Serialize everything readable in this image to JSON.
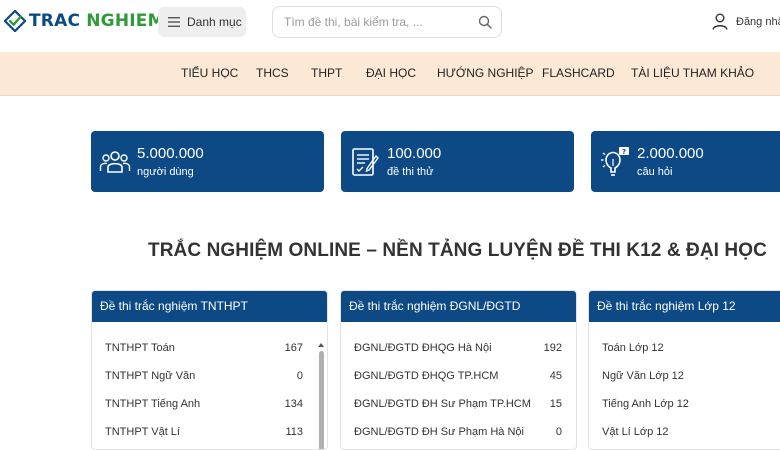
{
  "header": {
    "logo_main": "TRAC",
    "logo_accent": "NGHIEM",
    "menu_label": "Danh mục",
    "search_placeholder": "Tìm đề thi, bài kiểm tra, ...",
    "login_label": "Đăng nhập"
  },
  "nav": [
    {
      "label": "TIỂU HỌC"
    },
    {
      "label": "THCS"
    },
    {
      "label": "THPT"
    },
    {
      "label": "ĐẠI HỌC"
    },
    {
      "label": "HƯỚNG NGHIỆP"
    },
    {
      "label": "FLASHCARD"
    },
    {
      "label": "TÀI LIỆU THAM KHẢO"
    }
  ],
  "stats": [
    {
      "value": "5.000.000",
      "label": "người dùng",
      "icon": "users-icon"
    },
    {
      "value": "100.000",
      "label": "đề thi thử",
      "icon": "exam-sheet-icon"
    },
    {
      "value": "2.000.000",
      "label": "câu hỏi",
      "icon": "lightbulb-question-icon"
    }
  ],
  "heading": "TRẮC NGHIỆM ONLINE – NỀN TẢNG LUYỆN ĐỀ THI K12 & ĐẠI HỌC",
  "colors": {
    "brand_blue": "#0d4a85",
    "brand_green": "#2e9a3a",
    "nav_bg": "#fbe8d5"
  },
  "cards": [
    {
      "title": "Đề thi trắc nghiệm TNTHPT",
      "items": [
        {
          "name": "TNTHPT Toán",
          "count": "167"
        },
        {
          "name": "TNTHPT Ngữ Văn",
          "count": "0"
        },
        {
          "name": "TNTHPT Tiếng Anh",
          "count": "134"
        },
        {
          "name": "TNTHPT Vật Lí",
          "count": "113"
        }
      ]
    },
    {
      "title": "Đề thi trắc nghiệm ĐGNL/ĐGTD",
      "items": [
        {
          "name": "ĐGNL/ĐGTD ĐHQG Hà Nội",
          "count": "192"
        },
        {
          "name": "ĐGNL/ĐGTD ĐHQG TP.HCM",
          "count": "45"
        },
        {
          "name": "ĐGNL/ĐGTD ĐH Sư Phạm TP.HCM",
          "count": "15"
        },
        {
          "name": "ĐGNL/ĐGTD ĐH Sư Phạm Hà Nội",
          "count": "0"
        }
      ]
    },
    {
      "title": "Đề thi trắc nghiệm Lớp 12",
      "items": [
        {
          "name": "Toán Lớp 12",
          "count": ""
        },
        {
          "name": "Ngữ Văn Lớp 12",
          "count": ""
        },
        {
          "name": "Tiếng Anh Lớp 12",
          "count": ""
        },
        {
          "name": "Vật Lí Lớp 12",
          "count": ""
        }
      ]
    }
  ]
}
